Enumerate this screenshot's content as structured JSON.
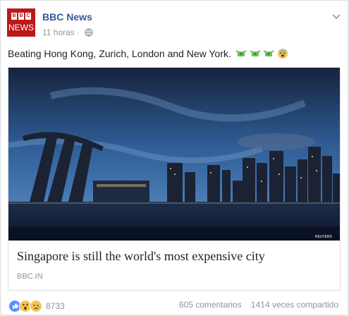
{
  "post": {
    "page_name": "BBC News",
    "avatar_logo_letters": [
      "B",
      "B",
      "C"
    ],
    "avatar_logo_text": "NEWS",
    "time": "11 horas",
    "separator": "·",
    "text": "Beating Hong Kong, Zurich, London and New York.",
    "text_emojis": [
      "money-with-wings",
      "money-with-wings",
      "money-with-wings",
      "fearful-face"
    ],
    "link": {
      "title": "Singapore is still the world's most expensive city",
      "domain": "BBC.IN",
      "image_credit": "REUTERS"
    },
    "reactions": {
      "icons": [
        "like",
        "wow",
        "sad"
      ],
      "count": "8733"
    },
    "comments": "605 comentarios",
    "shares": "1414 veces compartido"
  },
  "colors": {
    "brand_red": "#bb1919",
    "link_blue": "#365899",
    "meta_gray": "#90949c",
    "like_blue": "#5890ff",
    "reaction_yellow": "#f7c34a"
  }
}
